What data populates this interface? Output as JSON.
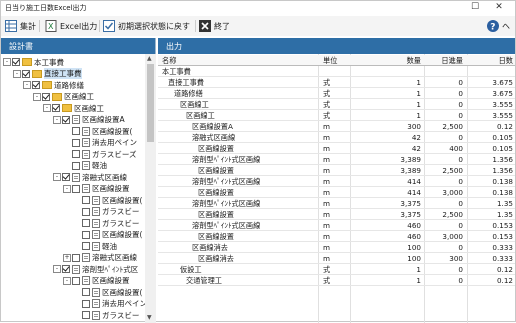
{
  "window": {
    "title": "日当り施工日数Excel出力"
  },
  "toolbar": {
    "summary": "集計",
    "excel": "Excel出力",
    "reset": "初期選択状態に戻す",
    "exit": "終了",
    "help": "ヘ"
  },
  "left_panel": {
    "title": "設計書"
  },
  "right_panel": {
    "title": "出力"
  },
  "tree": [
    {
      "label": "本工事費",
      "level": 0,
      "exp": "-",
      "checked": true,
      "icon": "folder-icon"
    },
    {
      "label": "直接工事費",
      "level": 1,
      "exp": "-",
      "checked": true,
      "icon": "folder-icon",
      "selected": true
    },
    {
      "label": "道路修繕",
      "level": 2,
      "exp": "-",
      "checked": true,
      "icon": "folder-icon"
    },
    {
      "label": "区画線工",
      "level": 3,
      "exp": "-",
      "checked": true,
      "icon": "folder-icon"
    },
    {
      "label": "区画線工",
      "level": 4,
      "exp": "-",
      "checked": true,
      "icon": "folder-icon"
    },
    {
      "label": "区画線設置A",
      "level": 5,
      "exp": "-",
      "checked": true,
      "icon": "doc-icon"
    },
    {
      "label": "区画線設置(",
      "level": 6,
      "exp": "",
      "checked": false,
      "icon": "doc-icon"
    },
    {
      "label": "消去用ペイン",
      "level": 6,
      "exp": "",
      "checked": false,
      "icon": "doc-icon"
    },
    {
      "label": "ガラスビーズ",
      "level": 6,
      "exp": "",
      "checked": false,
      "icon": "doc-icon"
    },
    {
      "label": "軽油",
      "level": 6,
      "exp": "",
      "checked": false,
      "icon": "doc-icon"
    },
    {
      "label": "溶融式区画線",
      "level": 5,
      "exp": "-",
      "checked": true,
      "icon": "doc-icon"
    },
    {
      "label": "区画線設置",
      "level": 6,
      "exp": "-",
      "checked": false,
      "icon": "doc-icon"
    },
    {
      "label": "区画線設置(",
      "level": 7,
      "exp": "",
      "checked": false,
      "icon": "doc-icon"
    },
    {
      "label": "ガラスビー",
      "level": 7,
      "exp": "",
      "checked": false,
      "icon": "doc-icon"
    },
    {
      "label": "ガラスビー",
      "level": 7,
      "exp": "",
      "checked": false,
      "icon": "doc-icon"
    },
    {
      "label": "区画線設置(",
      "level": 7,
      "exp": "",
      "checked": false,
      "icon": "doc-icon"
    },
    {
      "label": "軽油",
      "level": 7,
      "exp": "",
      "checked": false,
      "icon": "doc-icon"
    },
    {
      "label": "溶融式区画線",
      "level": 6,
      "exp": "+",
      "checked": false,
      "icon": "doc-icon"
    },
    {
      "label": "溶剤型ﾍﾟｲﾝﾄ式区",
      "level": 5,
      "exp": "-",
      "checked": true,
      "icon": "doc-icon"
    },
    {
      "label": "区画線設置",
      "level": 6,
      "exp": "-",
      "checked": false,
      "icon": "doc-icon"
    },
    {
      "label": "区画線設置(",
      "level": 7,
      "exp": "",
      "checked": false,
      "icon": "doc-icon"
    },
    {
      "label": "消去用ペイン",
      "level": 7,
      "exp": "",
      "checked": false,
      "icon": "doc-icon"
    },
    {
      "label": "ガラスビー",
      "level": 7,
      "exp": "",
      "checked": false,
      "icon": "doc-icon"
    }
  ],
  "table": {
    "headers": [
      "名称",
      "単位",
      "数量",
      "日進量",
      "日数"
    ],
    "rows": [
      {
        "name": "本工事費",
        "indent": 0,
        "unit": "",
        "qty": "",
        "daily": "",
        "days": ""
      },
      {
        "name": "直接工事費",
        "indent": 1,
        "unit": "式",
        "qty": "1",
        "daily": "0",
        "days": "3.675"
      },
      {
        "name": "道路修繕",
        "indent": 2,
        "unit": "式",
        "qty": "1",
        "daily": "0",
        "days": "3.675"
      },
      {
        "name": "区画線工",
        "indent": 3,
        "unit": "式",
        "qty": "1",
        "daily": "0",
        "days": "3.555"
      },
      {
        "name": "区画線工",
        "indent": 4,
        "unit": "式",
        "qty": "1",
        "daily": "0",
        "days": "3.555"
      },
      {
        "name": "区画線設置A",
        "indent": 5,
        "unit": "m",
        "qty": "300",
        "daily": "2,500",
        "days": "0.12"
      },
      {
        "name": "溶融式区画線",
        "indent": 5,
        "unit": "m",
        "qty": "42",
        "daily": "0",
        "days": "0.105"
      },
      {
        "name": "区画線設置",
        "indent": 6,
        "unit": "m",
        "qty": "42",
        "daily": "400",
        "days": "0.105"
      },
      {
        "name": "溶剤型ﾍﾟｲﾝﾄ式区画線",
        "indent": 5,
        "unit": "m",
        "qty": "3,389",
        "daily": "0",
        "days": "1.356"
      },
      {
        "name": "区画線設置",
        "indent": 6,
        "unit": "m",
        "qty": "3,389",
        "daily": "2,500",
        "days": "1.356"
      },
      {
        "name": "溶剤型ﾍﾟｲﾝﾄ式区画線",
        "indent": 5,
        "unit": "m",
        "qty": "414",
        "daily": "0",
        "days": "0.138"
      },
      {
        "name": "区画線設置",
        "indent": 6,
        "unit": "m",
        "qty": "414",
        "daily": "3,000",
        "days": "0.138"
      },
      {
        "name": "溶剤型ﾍﾟｲﾝﾄ式区画線",
        "indent": 5,
        "unit": "m",
        "qty": "3,375",
        "daily": "0",
        "days": "1.35"
      },
      {
        "name": "区画線設置",
        "indent": 6,
        "unit": "m",
        "qty": "3,375",
        "daily": "2,500",
        "days": "1.35"
      },
      {
        "name": "溶剤型ﾍﾟｲﾝﾄ式区画線",
        "indent": 5,
        "unit": "m",
        "qty": "460",
        "daily": "0",
        "days": "0.153"
      },
      {
        "name": "区画線設置",
        "indent": 6,
        "unit": "m",
        "qty": "460",
        "daily": "3,000",
        "days": "0.153"
      },
      {
        "name": "区画線消去",
        "indent": 5,
        "unit": "m",
        "qty": "100",
        "daily": "0",
        "days": "0.333"
      },
      {
        "name": "区画線消去",
        "indent": 6,
        "unit": "m",
        "qty": "100",
        "daily": "300",
        "days": "0.333"
      },
      {
        "name": "仮設工",
        "indent": 3,
        "unit": "式",
        "qty": "1",
        "daily": "0",
        "days": "0.12"
      },
      {
        "name": "交通管理工",
        "indent": 4,
        "unit": "式",
        "qty": "1",
        "daily": "0",
        "days": "0.12"
      }
    ]
  },
  "colors": {
    "header_blue": "#2e6ea6",
    "folder": "#f0c040",
    "selection": "#cfe3f5"
  }
}
